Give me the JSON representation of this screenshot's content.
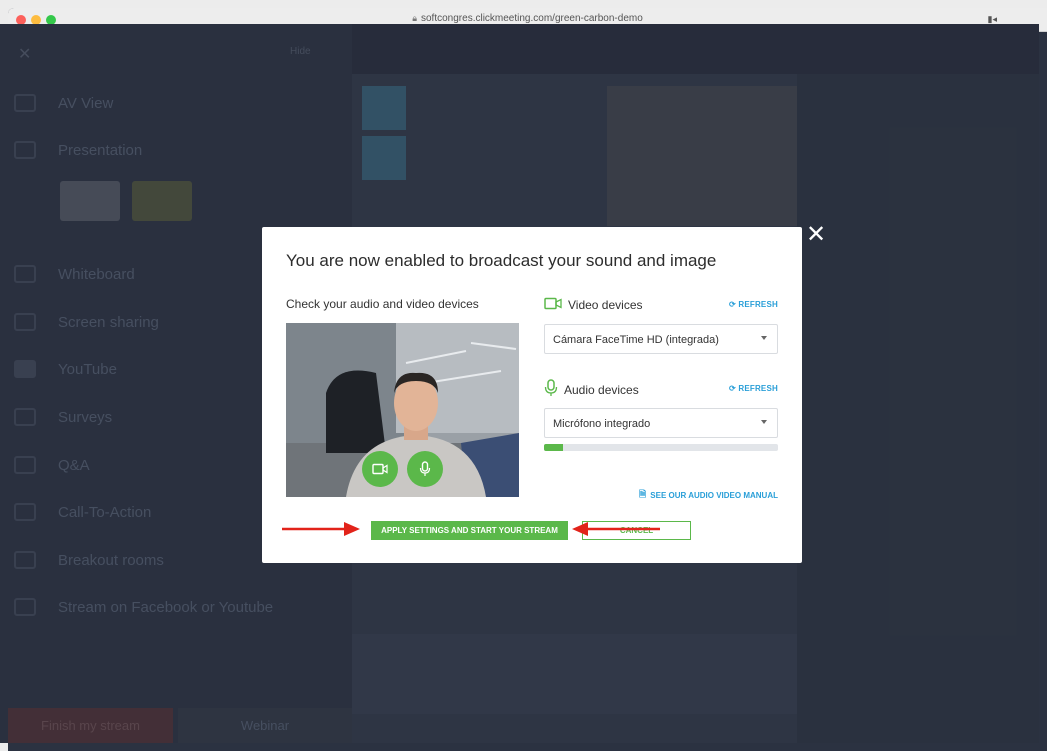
{
  "browser": {
    "url": "softcongres.clickmeeting.com/green-carbon-demo",
    "traffic_light_colors": [
      "#fc605b",
      "#fdbc40",
      "#34c84a"
    ]
  },
  "app_background": {
    "hide_label": "Hide",
    "sidebar_items": [
      {
        "label": "AV View",
        "icon": "av-view-icon"
      },
      {
        "label": "Presentation",
        "icon": "presentation-icon"
      },
      {
        "label": "Whiteboard",
        "icon": "whiteboard-icon"
      },
      {
        "label": "Screen sharing",
        "icon": "screen-sharing-icon"
      },
      {
        "label": "YouTube",
        "icon": "youtube-icon"
      },
      {
        "label": "Surveys",
        "icon": "surveys-icon"
      },
      {
        "label": "Q&A",
        "icon": "qa-icon"
      },
      {
        "label": "Call-To-Action",
        "icon": "cta-icon"
      },
      {
        "label": "Breakout rooms",
        "icon": "breakout-icon"
      },
      {
        "label": "Stream on Facebook or Youtube",
        "icon": "stream-icon"
      }
    ],
    "bottom_left_label": "Finish my stream",
    "bottom_right_label": "Webinar"
  },
  "modal": {
    "title": "You are now enabled to broadcast your sound and image",
    "check_devices_label": "Check your audio and video devices",
    "video": {
      "label": "Video devices",
      "refresh_label": "REFRESH",
      "selected": "Cámara FaceTime HD (integrada)"
    },
    "audio": {
      "label": "Audio devices",
      "refresh_label": "REFRESH",
      "selected": "Micrófono integrado",
      "level_fraction": 0.08
    },
    "manual_link": "SEE OUR AUDIO VIDEO MANUAL",
    "apply_button": "APPLY SETTINGS AND START YOUR STREAM",
    "cancel_button": "CANCEL",
    "close_symbol": "✕",
    "accent_color": "#5bb84a",
    "link_color": "#2a9fd8",
    "annotation_arrow_color": "#e2231a"
  }
}
